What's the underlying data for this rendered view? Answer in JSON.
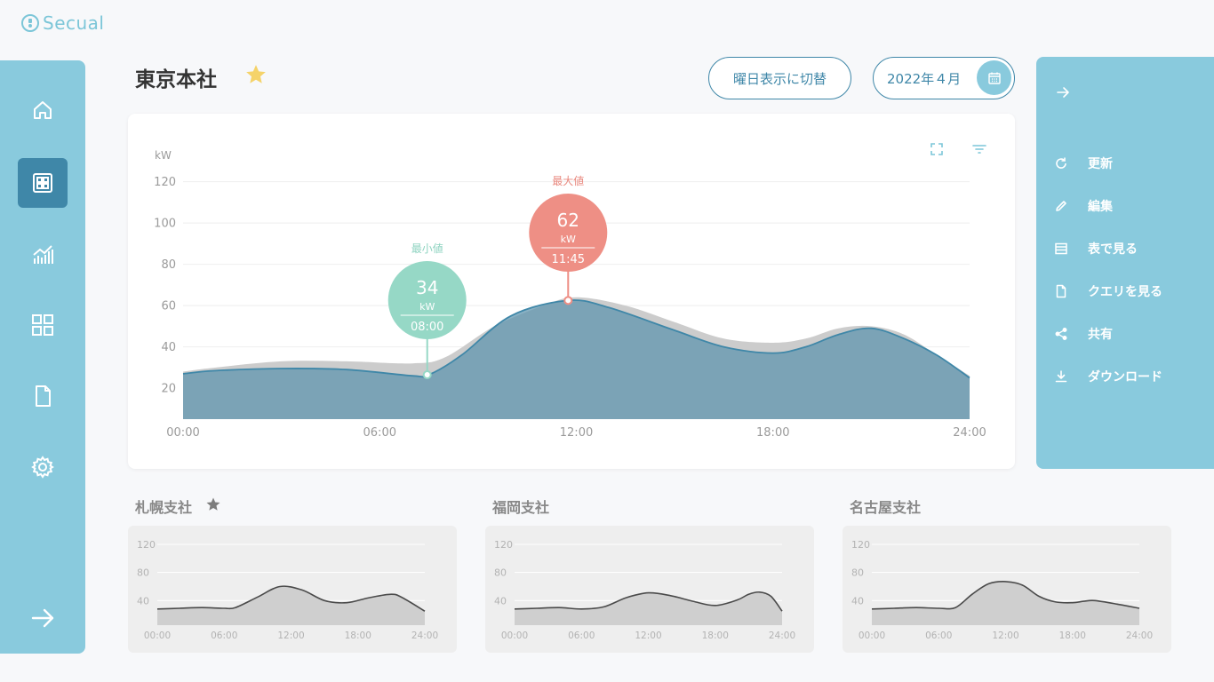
{
  "app": {
    "logo_text": "Secual"
  },
  "page": {
    "title": "東京本社",
    "switch_button": "曜日表示に切替",
    "date_value": "2022年４月"
  },
  "main_chart": {
    "chart_data": {
      "type": "area",
      "ylabel": "kW",
      "ylim": [
        5,
        125
      ],
      "yticks": [
        20,
        40,
        60,
        80,
        100,
        120
      ],
      "xlim": [
        0,
        24
      ],
      "xtick_labels": [
        "00:00",
        "06:00",
        "12:00",
        "18:00",
        "24:00"
      ],
      "grid": true,
      "series": [
        {
          "role": "comparison",
          "color": "#cccccc",
          "x": [
            0,
            1,
            3,
            5,
            7,
            8,
            9.5,
            11,
            12,
            13.5,
            15,
            16.5,
            18,
            19,
            20,
            21,
            22,
            23,
            24
          ],
          "y": [
            28,
            30,
            33,
            33,
            32,
            35,
            50,
            60,
            64,
            60,
            52,
            44,
            42,
            44,
            49,
            50,
            46,
            36,
            26
          ]
        },
        {
          "role": "current",
          "color": "#3f87a8",
          "x": [
            0,
            1,
            3,
            5,
            7,
            7.5,
            8.5,
            10,
            11.75,
            13,
            15,
            16.5,
            18,
            19,
            20,
            21,
            22,
            23,
            24
          ],
          "y": [
            27,
            28.5,
            29.5,
            29,
            26,
            26.5,
            36,
            55,
            62.5,
            59,
            48,
            40,
            37,
            40,
            46,
            49,
            44,
            36,
            25
          ]
        }
      ],
      "annotations": [
        {
          "label": "最小値",
          "value": "34",
          "unit": "kW",
          "time": "08:00",
          "x": 7.45,
          "y": 26.5,
          "color": "#96d8c6",
          "label_color": "#8ed3c0"
        },
        {
          "label": "最大値",
          "value": "62",
          "unit": "kW",
          "time": "11:45",
          "x": 11.75,
          "y": 62.5,
          "color": "#ee8f85",
          "label_color": "#e98a80"
        }
      ]
    }
  },
  "right_panel": {
    "items": [
      {
        "icon": "refresh-icon",
        "label": "更新"
      },
      {
        "icon": "pencil-icon",
        "label": "編集"
      },
      {
        "icon": "table-icon",
        "label": "表で見る"
      },
      {
        "icon": "document-icon",
        "label": "クエリを見る"
      },
      {
        "icon": "share-icon",
        "label": "共有"
      },
      {
        "icon": "download-icon",
        "label": "ダウンロード"
      }
    ]
  },
  "sidebar": {
    "items": [
      "home-icon",
      "dashboard-icon",
      "analytics-icon",
      "grid-icon",
      "document-icon",
      "settings-icon"
    ],
    "active": "dashboard-icon",
    "footer_icon": "arrow-right-icon"
  },
  "subcharts": [
    {
      "title": "札幌支社",
      "starred": true,
      "chart_data": {
        "type": "area",
        "ylim": [
          5,
          125
        ],
        "yticks": [
          40,
          80,
          120
        ],
        "xtick_labels": [
          "00:00",
          "06:00",
          "12:00",
          "18:00",
          "24:00"
        ],
        "x": [
          0,
          2,
          4,
          6,
          7,
          9,
          11,
          13,
          15,
          17,
          19,
          21,
          22,
          24
        ],
        "y": [
          28,
          29,
          30,
          29,
          30,
          45,
          60,
          55,
          40,
          37,
          44,
          49,
          44,
          25
        ]
      }
    },
    {
      "title": "福岡支社",
      "starred": false,
      "chart_data": {
        "type": "area",
        "ylim": [
          5,
          125
        ],
        "yticks": [
          40,
          80,
          120
        ],
        "xtick_labels": [
          "00:00",
          "06:00",
          "12:00",
          "18:00",
          "24:00"
        ],
        "x": [
          0,
          2,
          4,
          6,
          8,
          10,
          12,
          14,
          16,
          18,
          20,
          21,
          22,
          23,
          24
        ],
        "y": [
          28,
          29,
          30,
          28,
          31,
          44,
          51,
          47,
          39,
          33,
          41,
          49,
          52,
          46,
          25
        ]
      }
    },
    {
      "title": "名古屋支社",
      "starred": false,
      "chart_data": {
        "type": "area",
        "ylim": [
          5,
          125
        ],
        "yticks": [
          40,
          80,
          120
        ],
        "xtick_labels": [
          "00:00",
          "06:00",
          "12:00",
          "18:00",
          "24:00"
        ],
        "x": [
          0,
          2,
          4,
          6,
          7.5,
          9,
          10.5,
          12,
          13.5,
          15,
          16.5,
          18,
          19,
          20,
          22,
          24
        ],
        "y": [
          28,
          29,
          30,
          29,
          30,
          49,
          64,
          67,
          62,
          46,
          38,
          37,
          39,
          40,
          35,
          29
        ]
      }
    }
  ]
}
